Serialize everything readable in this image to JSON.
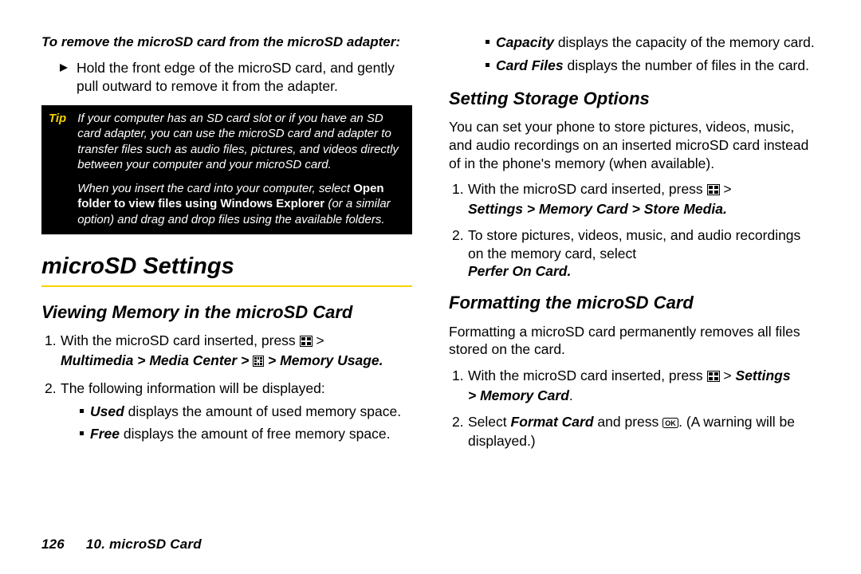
{
  "left": {
    "intro": "To remove the microSD card from the microSD adapter:",
    "bullet": "Hold the front edge of the microSD card, and gently pull outward to remove it from the adapter.",
    "tip_label": "Tip",
    "tip_p1": "If your computer has an SD card slot or if you have an SD card adapter, you can use the microSD card and adapter to transfer files such as audio files, pictures, and videos directly between your computer and your microSD card.",
    "tip_p2a": "When you insert the card into your computer, select ",
    "tip_p2b": "Open folder to view files using Windows Explorer",
    "tip_p2c": " (or a similar option) and drag and drop files using the available folders.",
    "h1": "microSD Settings",
    "h2": "Viewing Memory in the microSD Card",
    "step1a": "With the microSD card inserted, press ",
    "step1b": " > ",
    "step1_path": "Multimedia > Media Center > ",
    "step1_path2": " > Memory Usage.",
    "step2": "The following information will be displayed:",
    "sub_used_l": "Used",
    "sub_used_t": " displays the amount of used memory space.",
    "sub_free_l": "Free",
    "sub_free_t": " displays the amount of free memory space."
  },
  "right": {
    "sub_cap_l": "Capacity",
    "sub_cap_t": " displays the capacity of the memory card.",
    "sub_cf_l": "Card Files",
    "sub_cf_t": " displays the number of files in the card.",
    "h2a": "Setting Storage Options",
    "para_a": "You can set your phone to store pictures, videos, music, and audio recordings on an inserted microSD card instead of in the phone's memory (when available).",
    "step_a1a": "With the microSD card inserted, press ",
    "step_a1b": " > ",
    "step_a1_path": "Settings > Memory Card > Store Media.",
    "step_a2a": "To store pictures, videos, music, and audio recordings on the memory card, select ",
    "step_a2_path": "Perfer On Card.",
    "h2b": "Formatting the microSD Card",
    "para_b": "Formatting a microSD card permanently removes all files stored on the card.",
    "step_b1a": "With the microSD card inserted, press ",
    "step_b1b": " > ",
    "step_b1_path1": "Settings",
    "step_b1_path2": " > Memory Card",
    "step_b1_end": ".",
    "step_b2a": "Select ",
    "step_b2_path": "Format Card",
    "step_b2b": " and press ",
    "step_b2c": ". (A warning will be displayed.)"
  },
  "footer": {
    "page": "126",
    "chapter": "10. microSD Card"
  }
}
